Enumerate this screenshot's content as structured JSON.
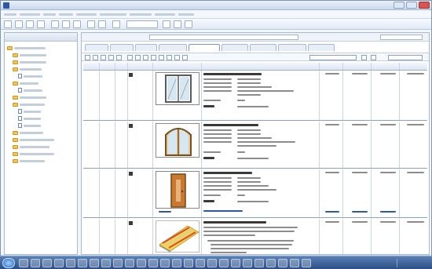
{
  "window": {
    "title": ""
  },
  "window_buttons": [
    {
      "label": ""
    },
    {
      "label": ""
    },
    {
      "label": ""
    }
  ],
  "menu": {
    "items": []
  },
  "sidebar": {
    "title": "",
    "items": []
  },
  "document": {
    "name_label": "",
    "name_value": "",
    "date_label": "",
    "date_value": ""
  },
  "tabs": [],
  "grid": {
    "columns": [],
    "rows": [
      {
        "title": "",
        "details": [],
        "values": []
      },
      {
        "title": "",
        "details": [],
        "values": []
      },
      {
        "title": "",
        "details": [],
        "values": []
      },
      {
        "title": "",
        "details": [],
        "values": []
      }
    ]
  },
  "colors": {
    "accent": "#2b59a6",
    "frame": "#7f95b0",
    "selection": "#cfe0f5"
  }
}
